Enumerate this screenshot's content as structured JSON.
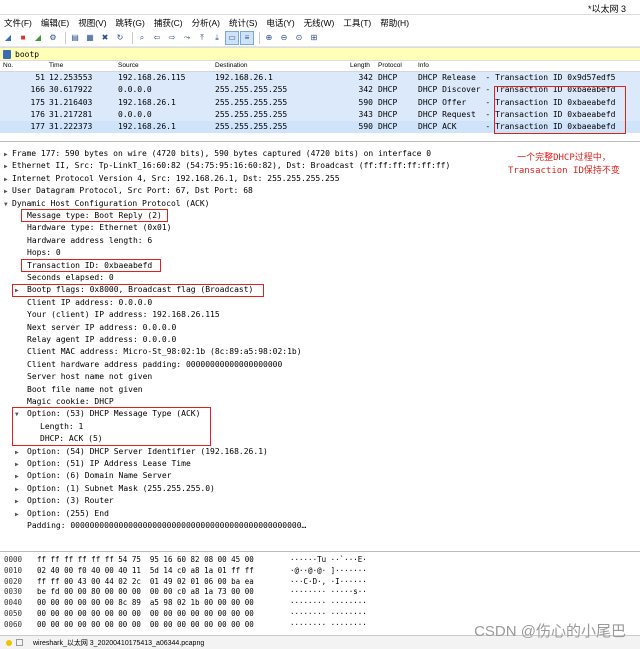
{
  "window": {
    "title": "*以太网 3"
  },
  "menu": [
    "文件(F)",
    "编辑(E)",
    "视图(V)",
    "跳转(G)",
    "捕获(C)",
    "分析(A)",
    "统计(S)",
    "电话(Y)",
    "无线(W)",
    "工具(T)",
    "帮助(H)"
  ],
  "filter": {
    "value": "bootp"
  },
  "packet_list": {
    "headers": {
      "no": "No.",
      "time": "Time",
      "source": "Source",
      "destination": "Destination",
      "length": "Length",
      "protocol": "Protocol",
      "info": "Info"
    },
    "rows": [
      {
        "no": "51",
        "time": "12.253553",
        "src": "192.168.26.115",
        "dst": "192.168.26.1",
        "len": "342",
        "proto": "DHCP",
        "info": "DHCP Release  - Transaction ID 0x9d57edf5"
      },
      {
        "no": "166",
        "time": "30.617922",
        "src": "0.0.0.0",
        "dst": "255.255.255.255",
        "len": "342",
        "proto": "DHCP",
        "info": "DHCP Discover - Transaction ID 0xbaeabefd"
      },
      {
        "no": "175",
        "time": "31.216403",
        "src": "192.168.26.1",
        "dst": "255.255.255.255",
        "len": "590",
        "proto": "DHCP",
        "info": "DHCP Offer    - Transaction ID 0xbaeabefd"
      },
      {
        "no": "176",
        "time": "31.217281",
        "src": "0.0.0.0",
        "dst": "255.255.255.255",
        "len": "343",
        "proto": "DHCP",
        "info": "DHCP Request  - Transaction ID 0xbaeabefd"
      },
      {
        "no": "177",
        "time": "31.222373",
        "src": "192.168.26.1",
        "dst": "255.255.255.255",
        "len": "590",
        "proto": "DHCP",
        "info": "DHCP ACK      - Transaction ID 0xbaeabefd"
      }
    ]
  },
  "details": {
    "frame": "Frame 177: 590 bytes on wire (4720 bits), 590 bytes captured (4720 bits) on interface 0",
    "ethernet": "Ethernet II, Src: Tp-LinkT_16:60:82 (54:75:95:16:60:82), Dst: Broadcast (ff:ff:ff:ff:ff:ff)",
    "ip": "Internet Protocol Version 4, Src: 192.168.26.1, Dst: 255.255.255.255",
    "udp": "User Datagram Protocol, Src Port: 67, Dst Port: 68",
    "dhcp": "Dynamic Host Configuration Protocol (ACK)",
    "message_type": "Message type: Boot Reply (2)",
    "hw_type": "Hardware type: Ethernet (0x01)",
    "hw_len": "Hardware address length: 6",
    "hops": "Hops: 0",
    "txid": "Transaction ID: 0xbaeabefd",
    "seconds": "Seconds elapsed: 0",
    "bootp_flags": "Bootp flags: 0x8000, Broadcast flag (Broadcast)",
    "client_ip": "Client IP address: 0.0.0.0",
    "your_ip": "Your (client) IP address: 192.168.26.115",
    "next_server": "Next server IP address: 0.0.0.0",
    "relay_agent": "Relay agent IP address: 0.0.0.0",
    "client_mac": "Client MAC address: Micro-St_98:02:1b (8c:89:a5:98:02:1b)",
    "hw_padding": "Client hardware address padding: 00000000000000000000",
    "server_host": "Server host name not given",
    "boot_file": "Boot file name not given",
    "magic": "Magic cookie: DHCP",
    "opt53": "Option: (53) DHCP Message Type (ACK)",
    "opt53_len": "Length: 1",
    "opt53_val": "DHCP: ACK (5)",
    "opt54": "Option: (54) DHCP Server Identifier (192.168.26.1)",
    "opt51": "Option: (51) IP Address Lease Time",
    "opt6": "Option: (6) Domain Name Server",
    "opt1": "Option: (1) Subnet Mask (255.255.255.0)",
    "opt3": "Option: (3) Router",
    "opt255": "Option: (255) End",
    "padding": "Padding: 000000000000000000000000000000000000000000000000…"
  },
  "annotation": {
    "line1": "一个完整DHCP过程中，",
    "line2": "Transaction ID保持不变"
  },
  "hex": [
    {
      "off": "0000",
      "bytes": "ff ff ff ff ff ff 54 75  95 16 60 82 08 00 45 00",
      "ascii": "······Tu ··`···E·"
    },
    {
      "off": "0010",
      "bytes": "02 40 00 f0 40 00 40 11  5d 14 c0 a8 1a 01 ff ff",
      "ascii": "·@··@·@· ]·······"
    },
    {
      "off": "0020",
      "bytes": "ff ff 00 43 00 44 02 2c  01 49 02 01 06 00 ba ea",
      "ascii": "···C·D·, ·I······"
    },
    {
      "off": "0030",
      "bytes": "be fd 00 00 80 00 00 00  00 00 c0 a8 1a 73 00 00",
      "ascii": "········ ·····s··"
    },
    {
      "off": "0040",
      "bytes": "00 00 00 00 00 00 8c 89  a5 98 02 1b 00 00 00 00",
      "ascii": "········ ········"
    },
    {
      "off": "0050",
      "bytes": "00 00 00 00 00 00 00 00  00 00 00 00 00 00 00 00",
      "ascii": "········ ········"
    },
    {
      "off": "0060",
      "bytes": "00 00 00 00 00 00 00 00  00 00 00 00 00 00 00 00",
      "ascii": "········ ········"
    }
  ],
  "status": {
    "file": "wireshark_以太网 3_20200410175413_a06344.pcapng"
  },
  "watermark": "CSDN @伤心的小尾巴"
}
